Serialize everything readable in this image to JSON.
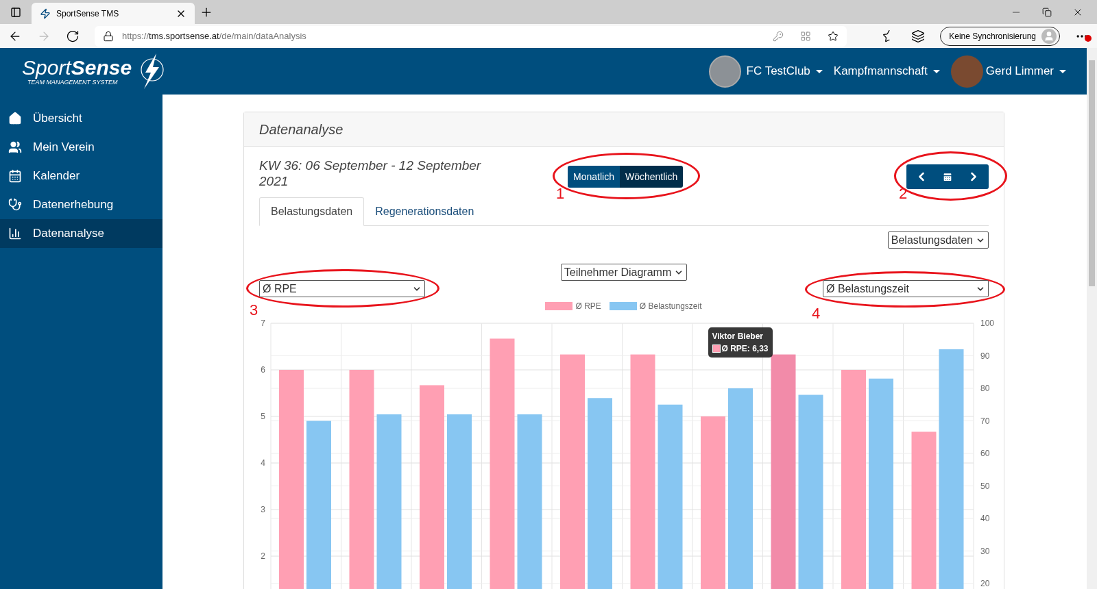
{
  "browser": {
    "tab_title": "SportSense TMS",
    "url": "https://**tms.sportsense.at**/de/main/dataAnalysis",
    "sync_button": "Keine Synchronisierung"
  },
  "header": {
    "logo_title": "Sport**Sense**",
    "logo_subtitle": "TEAM MANAGEMENT SYSTEM",
    "club": "FC TestClub",
    "team": "Kampfmannschaft",
    "user": "Gerd Limmer"
  },
  "sidebar": {
    "items": [
      {
        "label": "Übersicht",
        "selected": false
      },
      {
        "label": "Mein Verein",
        "selected": false
      },
      {
        "label": "Kalender",
        "selected": false
      },
      {
        "label": "Datenerhebung",
        "selected": false
      },
      {
        "label": "Datenanalyse",
        "selected": true
      }
    ]
  },
  "card": {
    "title": "Datenanalyse",
    "period": "KW 36: 06 September - 12 September 2021",
    "period_toggle": [
      {
        "label": "Monatlich",
        "selected": false
      },
      {
        "label": "Wöchentlich",
        "selected": true
      }
    ],
    "tabs": [
      {
        "label": "Belastungsdaten",
        "selected": true
      },
      {
        "label": "Regenerationsdaten",
        "selected": false
      }
    ],
    "data_select": "Belastungsdaten",
    "diagram_select": "Teilnehmer Diagramm",
    "left_metric_select": "Ø RPE",
    "right_metric_select": "Ø Belastungszeit",
    "chart_data": {
      "type": "bar",
      "stacked": false,
      "grid": true,
      "legend": "top",
      "ylim": [
        1,
        7
      ],
      "yticks": [
        2,
        3,
        4,
        5,
        6,
        7
      ],
      "y2lim": [
        0,
        100
      ],
      "y2ticks": [
        20,
        30,
        40,
        50,
        60,
        70,
        80,
        90,
        100
      ],
      "series": [
        {
          "name": "Ø RPE",
          "color": "#ff9fb3",
          "values": [
            6,
            6,
            5.67,
            6.67,
            6.33,
            6.33,
            5,
            6.33,
            6,
            4.67
          ]
        },
        {
          "name": "Ø Belastungszeit",
          "color": "#87c6f2",
          "axis": "y2",
          "values": [
            70,
            72,
            72,
            72,
            77,
            75,
            80,
            78,
            83,
            92
          ]
        }
      ],
      "annotations": [
        "Viktor Bieber",
        "Ø RPE: 6,33"
      ]
    }
  },
  "markup": [
    {
      "label": "1"
    },
    {
      "label": "2"
    },
    {
      "label": "3"
    },
    {
      "label": "4"
    }
  ]
}
